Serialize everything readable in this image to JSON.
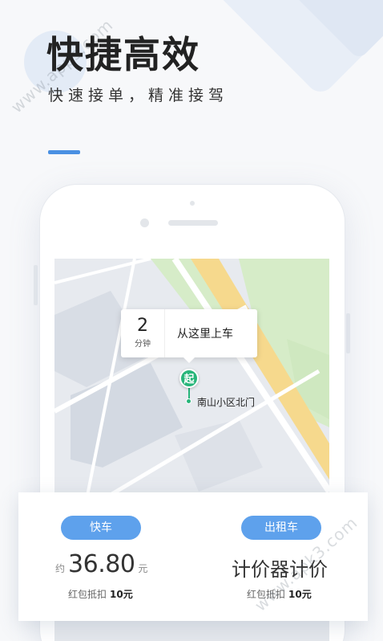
{
  "header": {
    "title": "快捷高效",
    "subtitle": "快速接单，精准接驾"
  },
  "watermark": {
    "text_top": "www.apps.com",
    "text_bottom": "www.apk3.com"
  },
  "map": {
    "eta_value": "2",
    "eta_unit": "分钟",
    "pickup_prompt": "从这里上车",
    "pin_label": "起",
    "place_name": "南山小区北门"
  },
  "card": {
    "left": {
      "tag": "快车",
      "price_prefix": "约",
      "price": "36.80",
      "price_suffix": "元",
      "discount_label": "红包抵扣",
      "discount_value": "10元"
    },
    "right": {
      "tag": "出租车",
      "price_text": "计价器计价",
      "discount_label": "红包抵扣",
      "discount_value": "10元"
    }
  },
  "colors": {
    "accent": "#4a90e2",
    "tag_bg": "#5ea1ec",
    "pin_green": "#27b57a",
    "road_yellow": "#f6d98d",
    "park_green": "#d6ecc8"
  }
}
